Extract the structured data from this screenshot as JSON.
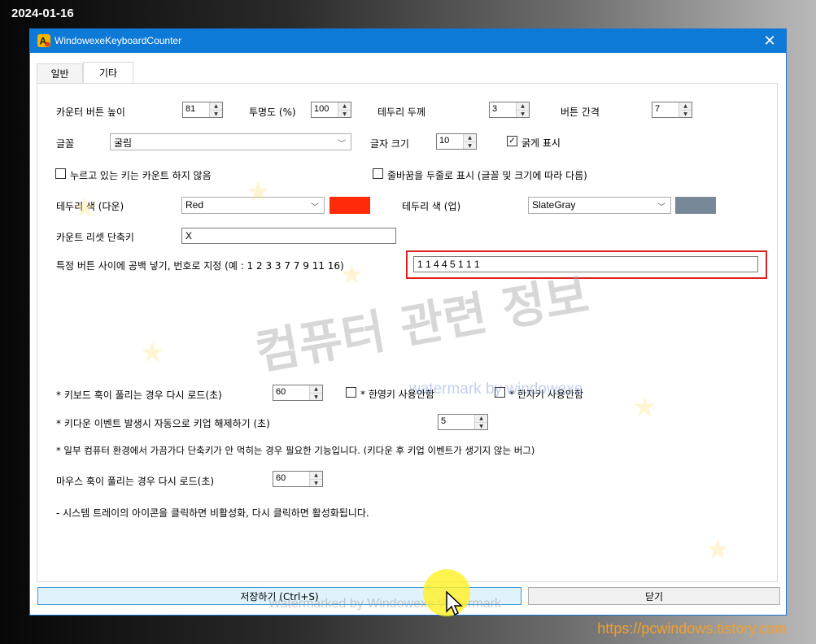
{
  "overlay": {
    "date": "2024-01-16",
    "blog_url": "https://pcwindows.tistory.com"
  },
  "window": {
    "title": "WindowexeKeyboardCounter",
    "close_glyph": "✕"
  },
  "tabs": [
    {
      "label": "일반",
      "active": false
    },
    {
      "label": "기타",
      "active": true
    }
  ],
  "settings": {
    "counter_button_height_label": "카운터 버튼 높이",
    "counter_button_height_value": "81",
    "opacity_label": "투명도 (%)",
    "opacity_value": "100",
    "border_thickness_label": "테두리 두께",
    "border_thickness_value": "3",
    "button_spacing_label": "버튼 간격",
    "button_spacing_value": "7",
    "font_label": "글꼴",
    "font_value": "굴림",
    "font_size_label": "글자 크기",
    "font_size_value": "10",
    "bold_label": "굵게 표시",
    "bold_checked": true,
    "no_count_held_label": "누르고 있는 키는 카운트 하지 않음",
    "no_count_held_checked": false,
    "two_line_label": "줄바꿈을 두줄로 표시 (글꼴 및 크기에 따라 다름)",
    "two_line_checked": false,
    "border_color_down_label": "테두리 색 (다운)",
    "border_color_down_value": "Red",
    "border_color_down_swatch": "#ff2a0a",
    "border_color_up_label": "테두리 색 (업)",
    "border_color_up_value": "SlateGray",
    "border_color_up_swatch": "#798898",
    "reset_shortcut_label": "카운트 리셋 단축키",
    "reset_shortcut_value": "X",
    "gap_buttons_label": "특정 버튼 사이에 공백 넣기, 번호로 지정 (예 : 1 2 3 3 7 7 9 11 16)",
    "gap_buttons_value": "1 1 4 4 5 1 1 1",
    "keyboard_reload_label": "* 키보드 훅이 풀리는 경우 다시 로드(초)",
    "keyboard_reload_value": "60",
    "hangul_key_label": "* 한영키 사용안함",
    "hangul_key_checked": false,
    "hanja_key_label": "* 한자키 사용안함",
    "hanja_key_checked": false,
    "keyup_release_label": "* 키다운 이벤트 발생시 자동으로 키업 해제하기 (초)",
    "keyup_release_value": "5",
    "note_label": "* 일부 컴퓨터 환경에서 가끔가다 단축키가 안 먹히는 경우 필요한 기능입니다. (키다운 후 키업 이벤트가 생기지 않는 버그)",
    "mouse_reload_label": "마우스 훅이 풀리는 경우 다시 로드(초)",
    "mouse_reload_value": "60",
    "tray_note": "- 시스템 트레이의 아이콘을 클릭하면 비활성화, 다시 클릭하면 활성화됩니다."
  },
  "buttons": {
    "save_label": "저장하기 (Ctrl+S)",
    "close_label": "닫기"
  },
  "watermarks": {
    "korean": "컴퓨터 관련 정보",
    "english": "watermark by windowexe",
    "bottom": "Watermarked by Windowexe Watermark"
  },
  "colors": {
    "titlebar": "#0d7ad8",
    "highlight": "#e02020",
    "save_button_bg": "#e0f3fd",
    "blog_url": "#f2a02c"
  },
  "icons": {
    "app": "keyboard-app-icon",
    "close": "close-icon",
    "spin_up": "spin-up-icon",
    "spin_down": "spin-down-icon",
    "dropdown": "chevron-down-icon",
    "cursor": "mouse-cursor-icon"
  }
}
